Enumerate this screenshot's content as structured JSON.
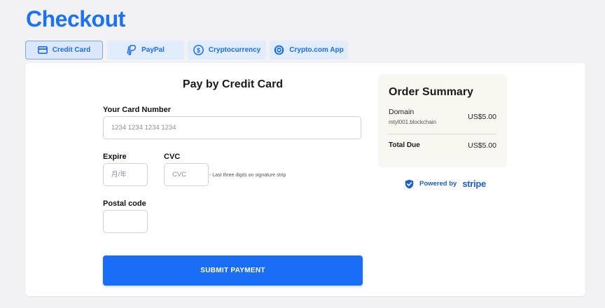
{
  "page": {
    "title": "Checkout"
  },
  "tabs": [
    {
      "label": "Credit Card",
      "icon": "credit-card-icon",
      "active": true
    },
    {
      "label": "PayPal",
      "icon": "paypal-icon",
      "active": false
    },
    {
      "label": "Cryptocurrency",
      "icon": "crypto-icon",
      "active": false
    },
    {
      "label": "Crypto.com App",
      "icon": "crypto-com-icon",
      "active": false
    }
  ],
  "form": {
    "title": "Pay by Credit Card",
    "card_number": {
      "label": "Your Card Number",
      "placeholder": "1234 1234 1234 1234",
      "value": ""
    },
    "expire": {
      "label": "Expire",
      "placeholder": "月/年",
      "value": ""
    },
    "cvc": {
      "label": "CVC",
      "placeholder": "CVC",
      "value": "",
      "hint": "- Last three digits on signature strip"
    },
    "postal": {
      "label": "Postal code",
      "value": ""
    },
    "submit_label": "SUBMIT PAYMENT"
  },
  "summary": {
    "title": "Order Summary",
    "item_name": "Domain",
    "item_detail": "mtyl001.blockchain",
    "item_price": "US$5.00",
    "total_label": "Total Due",
    "total_value": "US$5.00"
  },
  "powered": {
    "prefix": "Powered by",
    "brand": "stripe"
  },
  "colors": {
    "accent": "#1a6ef5",
    "title": "#1a73f5",
    "tab_bg": "#e1edfc",
    "summary_bg": "#f8f8f0",
    "page_bg": "#f2f2f4"
  }
}
